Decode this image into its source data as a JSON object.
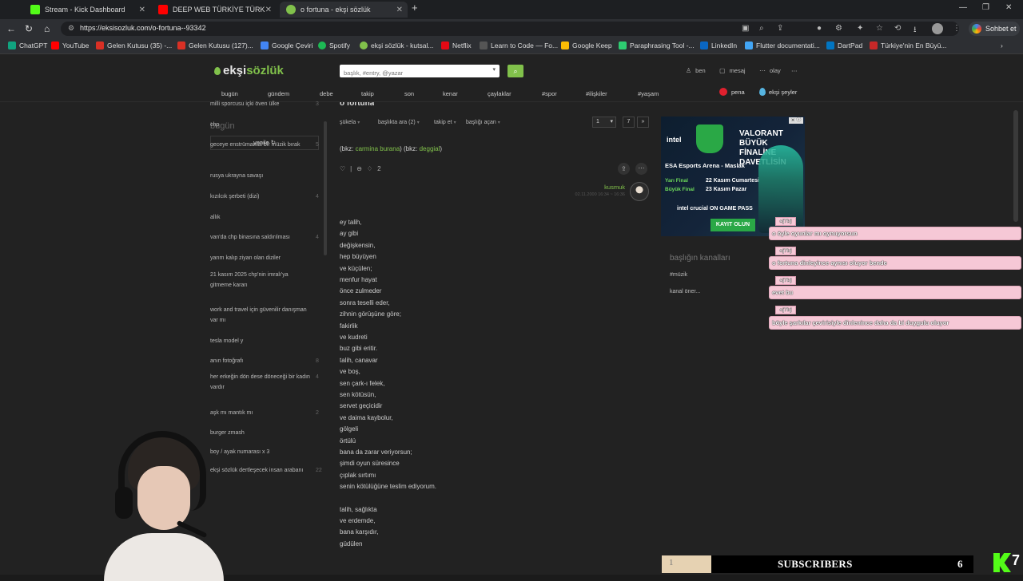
{
  "browser": {
    "tabs": [
      {
        "label": "Stream - Kick Dashboard",
        "color": "#53fc18"
      },
      {
        "label": "DEEP WEB TÜRKİYE TÜRK YORUM",
        "color": "#ff0000"
      },
      {
        "label": "o fortuna - ekşi sözlük",
        "color": "#81c14b"
      }
    ],
    "url": "https://eksisozluk.com/o-fortuna--93342",
    "sohbet_label": "Sohbet et",
    "bookmarks": [
      {
        "label": "ChatGPT",
        "color": "#10a37f"
      },
      {
        "label": "YouTube",
        "color": "#ff0000"
      },
      {
        "label": "Gelen Kutusu (35) -...",
        "color": "#d93025"
      },
      {
        "label": "Gelen Kutusu (127)...",
        "color": "#d93025"
      },
      {
        "label": "Google Çeviri",
        "color": "#4285f4"
      },
      {
        "label": "Spotify",
        "color": "#1db954"
      },
      {
        "label": "ekşi sözlük - kutsal...",
        "color": "#81c14b"
      },
      {
        "label": "Netflix",
        "color": "#e50914"
      },
      {
        "label": "Learn to Code — Fo...",
        "color": "#333333"
      },
      {
        "label": "Google Keep",
        "color": "#fbbc04"
      },
      {
        "label": "Paraphrasing Tool -...",
        "color": "#2ecc71"
      },
      {
        "label": "Flutter documentati...",
        "color": "#42a5f5"
      },
      {
        "label": "LinkedIn",
        "color": "#0a66c2"
      },
      {
        "label": "DartPad",
        "color": "#0175c2"
      },
      {
        "label": "Türkiye'nin En Büyü...",
        "color": "#c62828"
      }
    ]
  },
  "site": {
    "logo_left": "ekşi",
    "logo_right": "sözlük",
    "search_placeholder": "başlık, #entry, @yazar",
    "user_links": [
      "ben",
      "mesaj",
      "olay"
    ],
    "nav": [
      "bugün",
      "gündem",
      "debe",
      "takip",
      "son",
      "kenar",
      "çaylaklar",
      "#spor",
      "#ilişkiler",
      "#yaşam"
    ],
    "pena": "pena",
    "eksi_seyler": "ekşi şeyler"
  },
  "sidebar": {
    "title": "bugün",
    "refresh": "yenile ↻",
    "topics": [
      {
        "label": "milli sporcusu içki öven ülke",
        "count": "3"
      },
      {
        "label": "chp",
        "count": ""
      },
      {
        "label": "geceye enstrümantal bir müzik bırak",
        "count": "5"
      },
      {
        "label": "rusya ukrayna savaşı",
        "count": ""
      },
      {
        "label": "kızılcık şerbeti (dizi)",
        "count": "4"
      },
      {
        "label": "allık",
        "count": ""
      },
      {
        "label": "van'da chp binasına saldırılması",
        "count": "4"
      },
      {
        "label": "yarım kalıp ziyan olan diziler",
        "count": ""
      },
      {
        "label": "21 kasım 2025 chp'nin imralı'ya gitmeme kararı",
        "count": ""
      },
      {
        "label": "work and travel için güvenilir danışman var mı",
        "count": ""
      },
      {
        "label": "tesla model y",
        "count": ""
      },
      {
        "label": "anın fotoğrafı",
        "count": "8"
      },
      {
        "label": "her erkeğin dön dese döneceği bir kadın vardır",
        "count": "4"
      },
      {
        "label": "aşk mı mantık mı",
        "count": "2"
      },
      {
        "label": "burger zmash",
        "count": ""
      },
      {
        "label": "boy / ayak numarası x 3",
        "count": ""
      },
      {
        "label": "ekşi sözlük dertleşecek insan arabanı",
        "count": "22"
      }
    ]
  },
  "main": {
    "title": "o fortuna",
    "subnav": [
      "şükela",
      "başlıkta ara (2)",
      "takip et",
      "başlığı açan"
    ],
    "page_current": "1",
    "page_total": "7",
    "page_next": "»",
    "bkz_prefix": "(bkz: ",
    "bkz_link1": "carmina burana",
    "bkz_mid": ") (bkz: ",
    "bkz_link2": "deggial",
    "bkz_suffix": ")",
    "favorite_count": "2",
    "author": "kusmuk",
    "date": "02.11.2000 16:34 ~ 16:36",
    "poem": [
      "ey talih,",
      "ay gibi",
      "değişkensin,",
      "hep büyüyen",
      "ve küçülen;",
      "menfur hayat",
      "önce zulmeder",
      "sonra teselli eder,",
      "zihnin görüşüne göre;",
      "fakirlik",
      "ve kudreti",
      "buz gibi eritir.",
      "talih, canavar",
      "ve boş,",
      "sen çark-ı felek,",
      "sen kötüsün,",
      "servet geçicidir",
      "ve daima kaybolur,",
      "gölgeli",
      "örtülü",
      "bana da zarar veriyorsun;",
      "şimdi oyun süresince",
      "çıplak sırtımı",
      "senin kötülüğüne teslim ediyorum.",
      "talih, sağlıkta",
      "ve erdemde,",
      "bana karşıdır,",
      "güdülen"
    ]
  },
  "right": {
    "ad": {
      "brand": "intel",
      "title_line1": "VALORANT BÜYÜK",
      "title_line2": "FİNALİNE DAVETLİSİN",
      "venue": "ESA Esports Arena - Maslak",
      "label1": "Yarı Final",
      "label2": "Büyük Final",
      "date1": "22 Kasım Cumartesi",
      "date2": "23 Kasım Pazar",
      "sponsors": "intel   crucial   ON   GAME PASS",
      "cta": "KAYIT OLUN",
      "close": "⨯ ⓘ"
    },
    "channels_title": "başlığın kanalları",
    "channel": "#müzik",
    "suggest": "kanal öner..."
  },
  "chat": [
    {
      "user": "oj7bj",
      "message": "o öyle oyunlar mı oynuyorsun"
    },
    {
      "user": "oj7bj",
      "message": "o fortuna dinleyince aynısı oluyor bende"
    },
    {
      "user": "oj7bj",
      "message": "evet bu"
    },
    {
      "user": "oj7bj",
      "message": "böyle şarkılar çevirisiyle dinlenince daha da bi duygulu oluyor"
    }
  ],
  "overlay": {
    "subs_progress_label": "1",
    "subs_label": "SUBSCRIBERS",
    "subs_target": "6",
    "subs_fraction": 0.16,
    "kick_count": "7"
  }
}
